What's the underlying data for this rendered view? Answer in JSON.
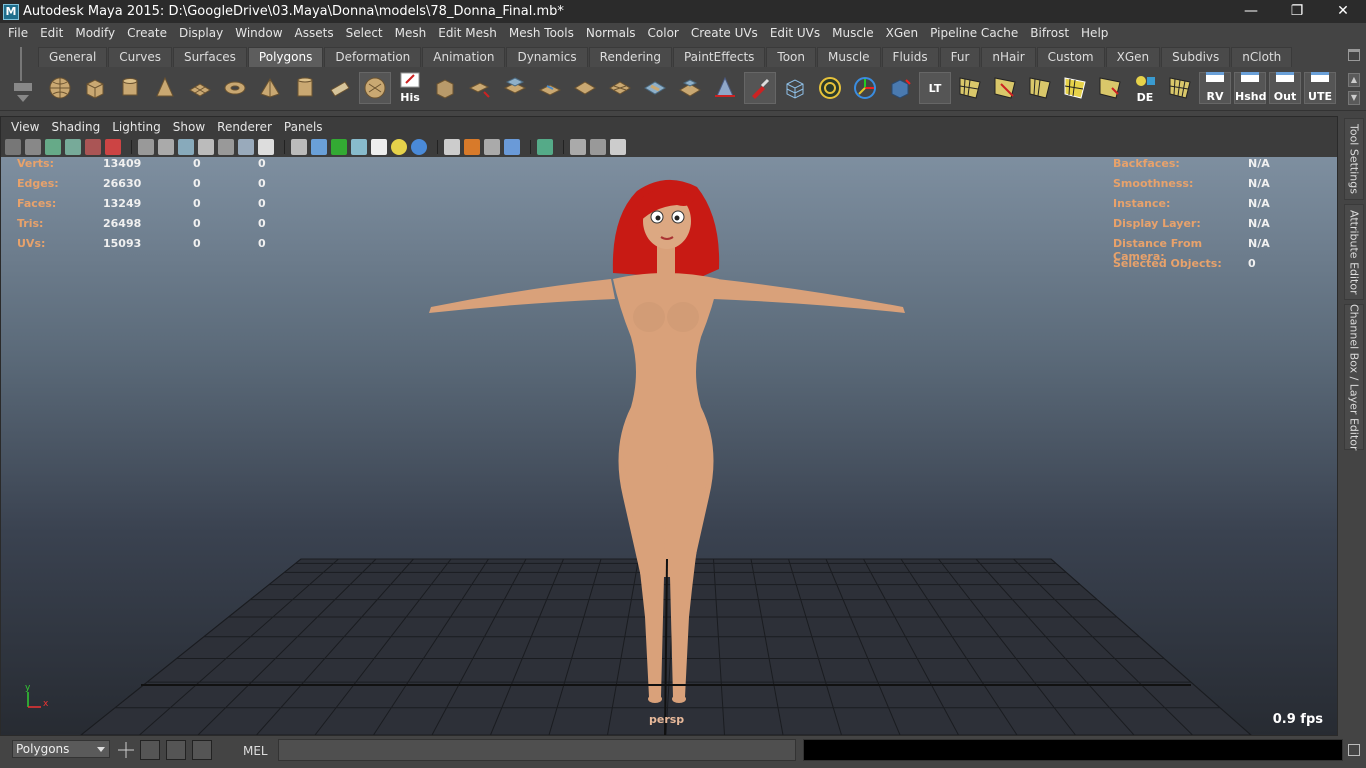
{
  "titlebar": {
    "icon": "M",
    "title": "Autodesk Maya 2015: D:\\GoogleDrive\\03.Maya\\Donna\\models\\78_Donna_Final.mb*"
  },
  "menubar": [
    "File",
    "Edit",
    "Modify",
    "Create",
    "Display",
    "Window",
    "Assets",
    "Select",
    "Mesh",
    "Edit Mesh",
    "Mesh Tools",
    "Normals",
    "Color",
    "Create UVs",
    "Edit UVs",
    "Muscle",
    "XGen",
    "Pipeline Cache",
    "Bifrost",
    "Help"
  ],
  "shelf": {
    "tabs": [
      "General",
      "Curves",
      "Surfaces",
      "Polygons",
      "Deformation",
      "Animation",
      "Dynamics",
      "Rendering",
      "PaintEffects",
      "Toon",
      "Muscle",
      "Fluids",
      "Fur",
      "nHair",
      "Custom",
      "XGen",
      "Subdivs",
      "nCloth"
    ],
    "active_tab": "Polygons",
    "icon_labels": {
      "his": "His",
      "lt": "LT",
      "de": "DE",
      "rv": "RV",
      "hshd": "Hshd",
      "out": "Out",
      "ute": "UTE"
    }
  },
  "panel": {
    "menu": [
      "View",
      "Shading",
      "Lighting",
      "Show",
      "Renderer",
      "Panels"
    ]
  },
  "hud": {
    "left": [
      {
        "label": "Verts:",
        "value": "13409",
        "a": "0",
        "b": "0"
      },
      {
        "label": "Edges:",
        "value": "26630",
        "a": "0",
        "b": "0"
      },
      {
        "label": "Faces:",
        "value": "13249",
        "a": "0",
        "b": "0"
      },
      {
        "label": "Tris:",
        "value": "26498",
        "a": "0",
        "b": "0"
      },
      {
        "label": "UVs:",
        "value": "15093",
        "a": "0",
        "b": "0"
      }
    ],
    "right": [
      {
        "label": "Backfaces:",
        "value": "N/A"
      },
      {
        "label": "Smoothness:",
        "value": "N/A"
      },
      {
        "label": "Instance:",
        "value": "N/A"
      },
      {
        "label": "Display Layer:",
        "value": "N/A"
      },
      {
        "label": "Distance From Camera:",
        "value": "N/A"
      },
      {
        "label": "Selected Objects:",
        "value": "0"
      }
    ],
    "camera": "persp",
    "fps": "0.9 fps",
    "axis_y": "y",
    "axis_x": "x"
  },
  "sidetabs": [
    "Tool Settings",
    "Attribute Editor",
    "Channel Box / Layer Editor"
  ],
  "cmdline": {
    "mode": "Polygons",
    "mel_label": "MEL"
  },
  "colors": {
    "skin": "#d9a17a",
    "hair": "#c81a14",
    "hud_label": "#e8a26b"
  }
}
